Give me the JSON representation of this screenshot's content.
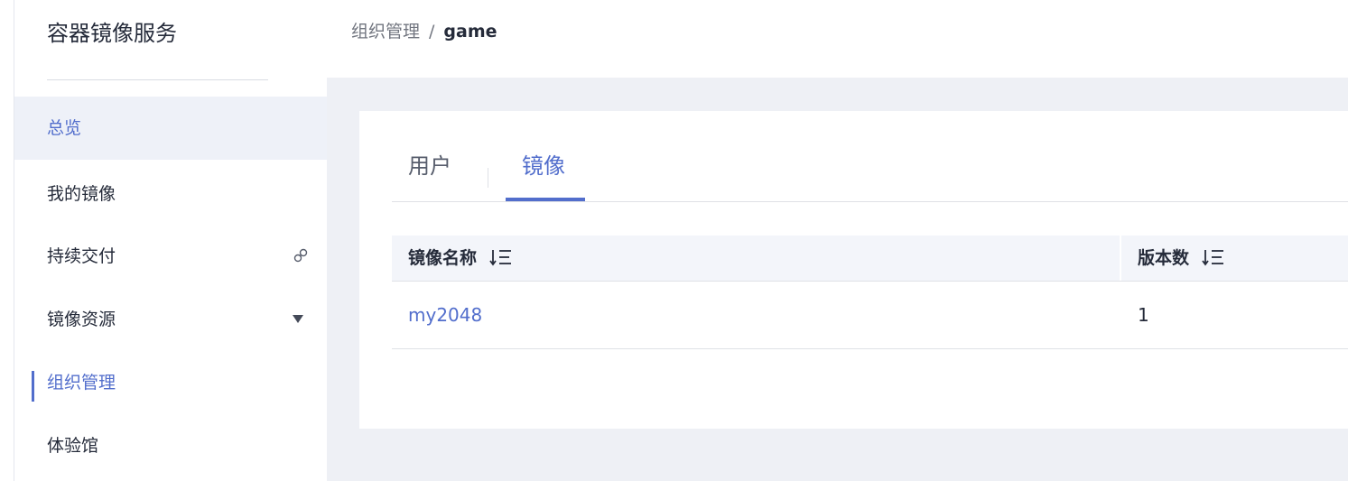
{
  "sidebar": {
    "title": "容器镜像服务",
    "items": [
      {
        "label": "总览"
      },
      {
        "label": "我的镜像"
      },
      {
        "label": "持续交付"
      },
      {
        "label": "镜像资源"
      },
      {
        "label": "组织管理"
      },
      {
        "label": "体验馆"
      }
    ]
  },
  "breadcrumb": {
    "parent": "组织管理",
    "separator": "/",
    "current": "game"
  },
  "tabs": [
    {
      "label": "用户"
    },
    {
      "label": "镜像"
    }
  ],
  "table": {
    "columns": [
      "镜像名称",
      "版本数"
    ],
    "rows": [
      {
        "name": "my2048",
        "versions": "1"
      }
    ]
  },
  "colors": {
    "accent": "#526ecc",
    "text": "#252b3a",
    "muted": "#71757f",
    "page_bg": "#eef0f5",
    "header_row_bg": "#f3f5fa"
  },
  "icons": {
    "link": "link-icon",
    "caret": "caret-down-icon",
    "sort": "sort-icon"
  }
}
